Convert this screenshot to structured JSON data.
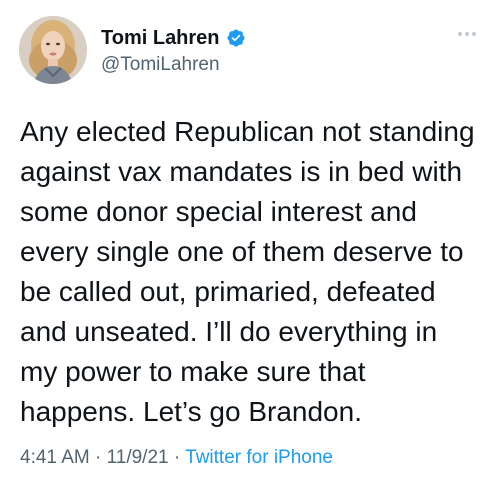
{
  "author": {
    "display_name": "Tomi Lahren",
    "handle": "@TomiLahren",
    "verified": true,
    "avatar_icon": "profile-photo"
  },
  "tweet": {
    "lines": [
      "Any elected Republican not standing",
      "against vax mandates is in bed with",
      "some donor special interest and",
      "every single one of them deserve to",
      "be called out, primaried, defeated",
      "and unseated. I’ll do everything in",
      "my power to make sure that",
      "happens. Let’s go Brandon."
    ]
  },
  "meta": {
    "time": "4:41 AM",
    "separator1": " · ",
    "date": "11/9/21",
    "separator2": " · ",
    "source": "Twitter for iPhone"
  },
  "colors": {
    "text": "#0f1419",
    "secondary": "#536471",
    "link": "#1d9bf0",
    "verified": "#1d9bf0"
  }
}
